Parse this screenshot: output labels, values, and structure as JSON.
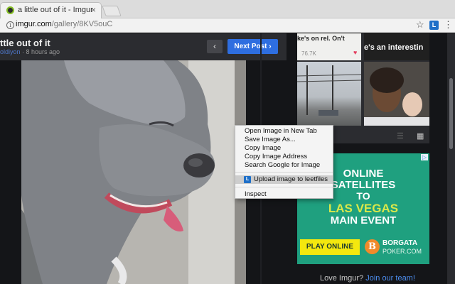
{
  "browser": {
    "tab_title": "a little out of it - Imgur",
    "tab_close": "×",
    "url_host": "imgur.com",
    "url_path": "/gallery/8KV5ouC",
    "ext_label": "L",
    "menu_glyph": "⋮",
    "star_glyph": "☆",
    "info_glyph": "i"
  },
  "post": {
    "title": "ttle out of it",
    "user": "oldiyon",
    "time": " · 8 hours ago",
    "prev_glyph": "‹",
    "next_label": "Next Post ›"
  },
  "sidebar": {
    "thumb_top_text_a": "ke's on rel. On't",
    "thumb_top_text_b": "e's an interestin",
    "views": "76.7K",
    "heart_glyph": "♥",
    "grid_glyph": "▦",
    "list_glyph": "☰"
  },
  "ad": {
    "choices": "▷",
    "line1": "ONLINE",
    "line2": "SATELLITES",
    "line3": "TO",
    "line4": "LAS VEGAS",
    "line5": "MAIN EVENT",
    "cta": "PLAY ONLINE",
    "logo_mark": "B",
    "logo_1": "BORGATA",
    "logo_2": "POKER.COM"
  },
  "footer": {
    "prefix": "Love Imgur? ",
    "link": "Join our team!"
  },
  "context_menu": {
    "items": [
      "Open Image in New Tab",
      "Save Image As...",
      "Copy Image",
      "Copy Image Address",
      "Search Google for Image",
      "Upload image to leetfiles",
      "Inspect"
    ],
    "ext_icon": "L"
  },
  "colors": {
    "accent_blue": "#2e6ee0",
    "ad_green": "#1fa07f",
    "ad_yellow": "#f4e80e"
  }
}
